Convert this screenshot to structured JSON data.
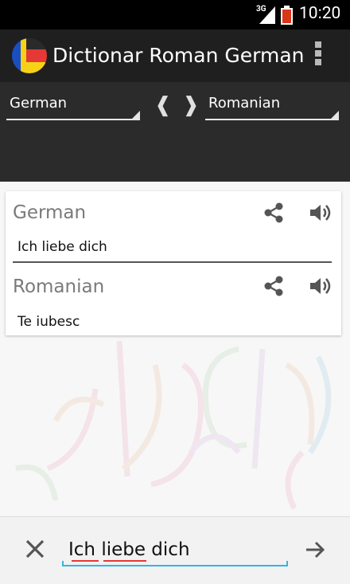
{
  "status_bar": {
    "network": "3G",
    "time": "10:20"
  },
  "app_bar": {
    "title": "Dictionar Roman German",
    "logo_colors": [
      "#1a4fc4",
      "#f7d117",
      "#e53935"
    ]
  },
  "language_selector": {
    "source": "German",
    "target": "Romanian",
    "swap_left_glyph": "❰",
    "swap_right_glyph": "❱"
  },
  "result_card": {
    "source_language": "German",
    "source_text": "Ich liebe dich",
    "target_language": "Romanian",
    "target_text": "Te iubesc"
  },
  "input": {
    "value": "Ich liebe dich"
  },
  "colors": {
    "accent": "#33b5e5",
    "spell_error": "#e53935",
    "action_bar": "#1f1f1f"
  }
}
